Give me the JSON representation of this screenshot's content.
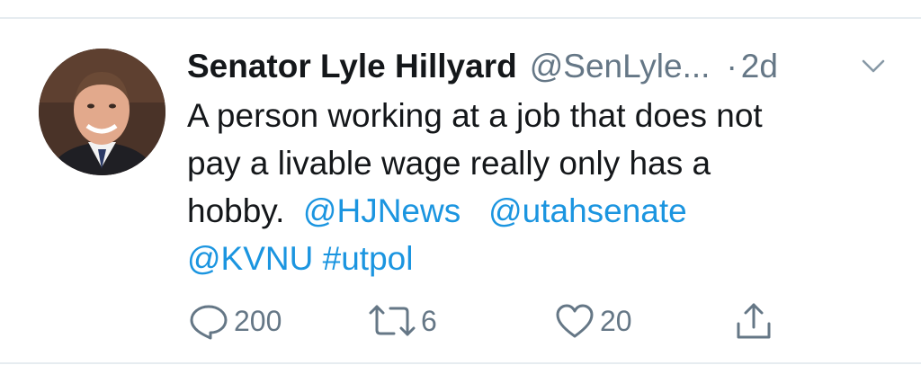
{
  "tweet": {
    "author_name": "Senator Lyle Hillyard",
    "handle": "@SenLyle...",
    "separator": "·",
    "time": "2d",
    "text_line1": "A person working at a job that does not",
    "text_line2": "pay a livable wage really only has a",
    "text_line3_plain": "hobby.",
    "mention_hjnews": "@HJNews",
    "mention_utahsenate": "@utahsenate",
    "mention_kvnu": "@KVNU",
    "hashtag_utpol": "#utpol"
  },
  "actions": {
    "reply_count": "200",
    "retweet_count": "6",
    "like_count": "20"
  },
  "icons": {
    "reply": "reply-icon",
    "retweet": "retweet-icon",
    "like": "heart-icon",
    "share": "share-icon",
    "menu": "chevron-down-icon"
  },
  "colors": {
    "link": "#1b95e0",
    "secondary": "#657786",
    "text": "#14171a",
    "divider": "#e6ecf0"
  }
}
